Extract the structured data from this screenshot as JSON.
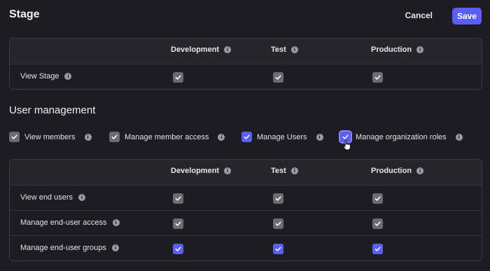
{
  "header": {
    "title": "Stage",
    "cancel_label": "Cancel",
    "save_label": "Save"
  },
  "stage_table": {
    "columns": [
      "Development",
      "Test",
      "Production"
    ],
    "rows": [
      {
        "label": "View Stage",
        "values": [
          true,
          true,
          true
        ]
      }
    ]
  },
  "user_management": {
    "title": "User management",
    "options": [
      {
        "label": "View members",
        "checked": true,
        "style": "gray"
      },
      {
        "label": "Manage member access",
        "checked": true,
        "style": "gray"
      },
      {
        "label": "Manage Users",
        "checked": true,
        "style": "blue"
      },
      {
        "label": "Manage organization roles",
        "checked": true,
        "style": "blue-hover"
      }
    ]
  },
  "users_table": {
    "columns": [
      "Development",
      "Test",
      "Production"
    ],
    "rows": [
      {
        "label": "View end users",
        "values": [
          true,
          true,
          true
        ],
        "style": "gray"
      },
      {
        "label": "Manage end-user access",
        "values": [
          true,
          true,
          true
        ],
        "style": "gray"
      },
      {
        "label": "Manage end-user groups",
        "values": [
          true,
          true,
          true
        ],
        "style": "blue"
      }
    ]
  },
  "colors": {
    "accent": "#5b5ef5",
    "background": "#1c1c22",
    "checkbox_gray": "#6b6b76"
  }
}
